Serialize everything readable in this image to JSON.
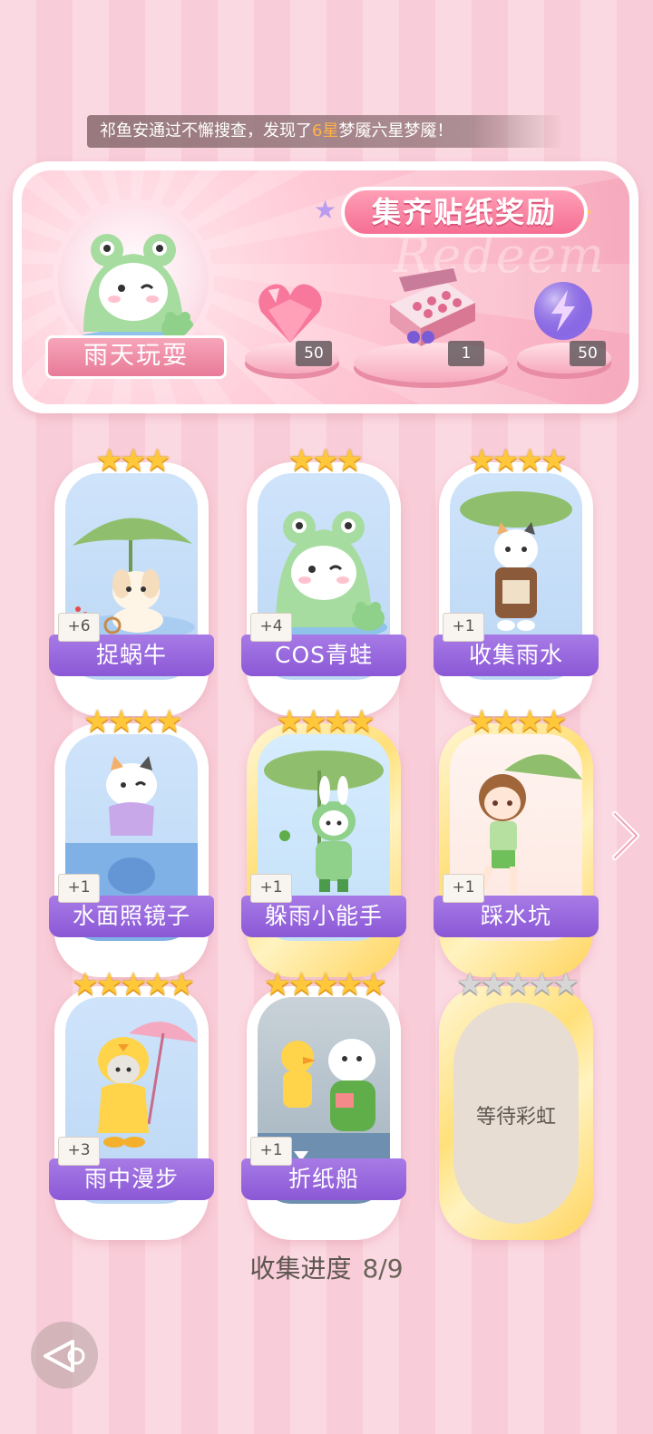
{
  "ticker": {
    "prefix": "祁鱼安通过不懈搜查，发现了",
    "highlight": "6星",
    "suffix": "梦魇六星梦魇！"
  },
  "banner": {
    "title": "集齐贴纸奖励",
    "watermark": "Redeem",
    "set_name": "雨天玩耍",
    "rewards": [
      {
        "icon": "pink-heart-gem-icon",
        "count": "50"
      },
      {
        "icon": "gift-box-icon",
        "count": "1"
      },
      {
        "icon": "purple-energy-orb-icon",
        "count": "50"
      }
    ]
  },
  "cards": [
    {
      "name": "捉蜗牛",
      "count": "+6",
      "stars": "★★★"
    },
    {
      "name": "COS青蛙",
      "count": "+4",
      "stars": "★★★"
    },
    {
      "name": "收集雨水",
      "count": "+1",
      "stars": "★★★★"
    },
    {
      "name": "水面照镜子",
      "count": "+1",
      "stars": "★★★★"
    },
    {
      "name": "躲雨小能手",
      "count": "+1",
      "stars": "★★★★"
    },
    {
      "name": "踩水坑",
      "count": "+1",
      "stars": "★★★★"
    },
    {
      "name": "雨中漫步",
      "count": "+3",
      "stars": "★★★★★"
    },
    {
      "name": "折纸船",
      "count": "+1",
      "stars": "★★★★★"
    },
    {
      "name": "等待彩虹",
      "stars": "★★★★★"
    }
  ],
  "progress": {
    "label": "收集进度",
    "value": "8/9"
  },
  "colors": {
    "accent_pink": "#f56f93",
    "label_purple": "#8b58d6",
    "star_gold": "#ffc73a"
  }
}
